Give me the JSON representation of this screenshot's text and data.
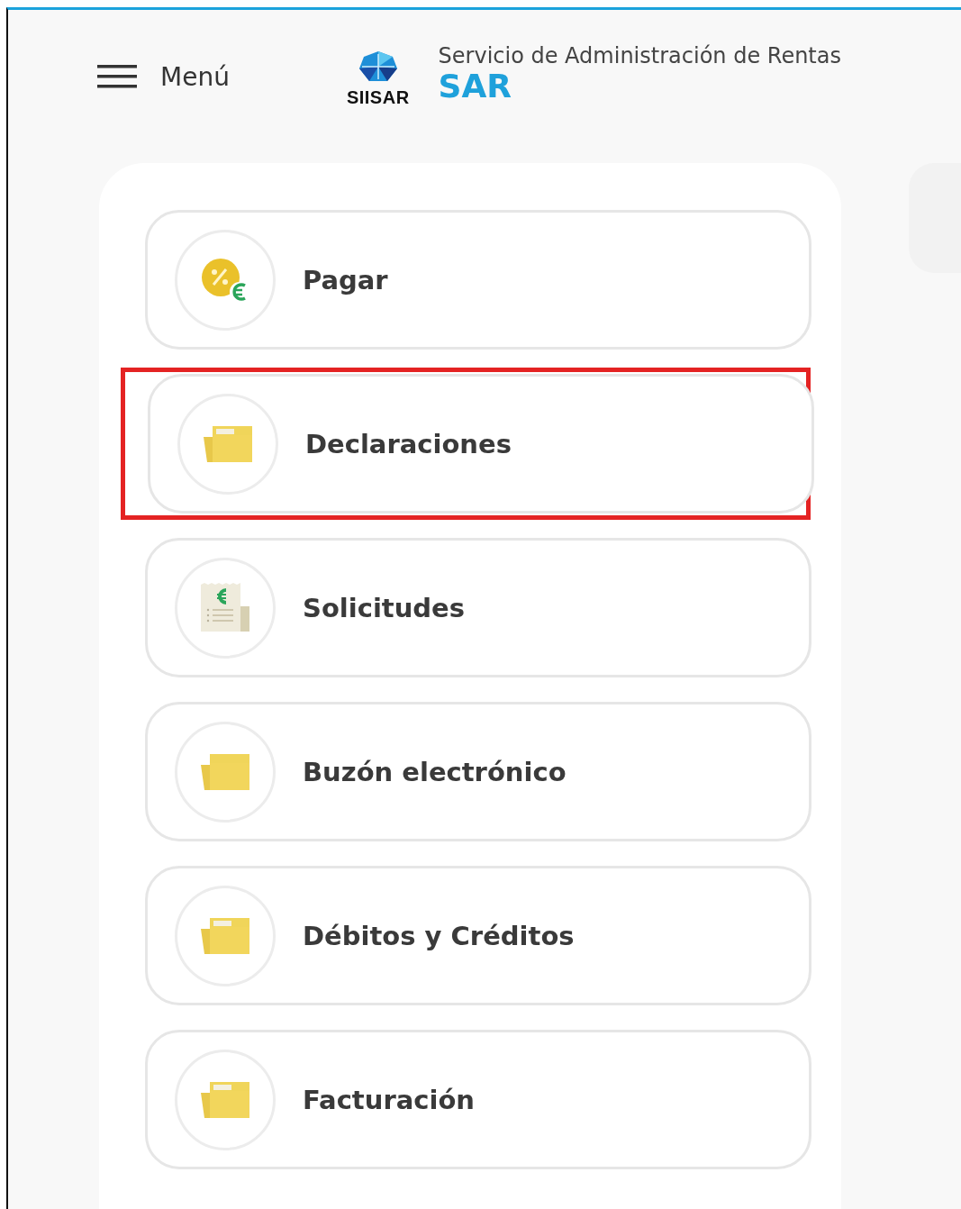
{
  "header": {
    "menu_label": "Menú",
    "logo_text": "SIISAR",
    "org_name": "Servicio de Administración de Rentas",
    "org_short": "SAR"
  },
  "items": [
    {
      "label": "Pagar",
      "kind": "coin",
      "highlighted": false
    },
    {
      "label": "Declaraciones",
      "kind": "folder-with-paper",
      "highlighted": true
    },
    {
      "label": "Solicitudes",
      "kind": "receipt",
      "highlighted": false
    },
    {
      "label": "Buzón electrónico",
      "kind": "folder",
      "highlighted": false
    },
    {
      "label": "Débitos y Créditos",
      "kind": "folder-with-paper",
      "highlighted": false
    },
    {
      "label": "Facturación",
      "kind": "folder-with-paper",
      "highlighted": false
    }
  ]
}
